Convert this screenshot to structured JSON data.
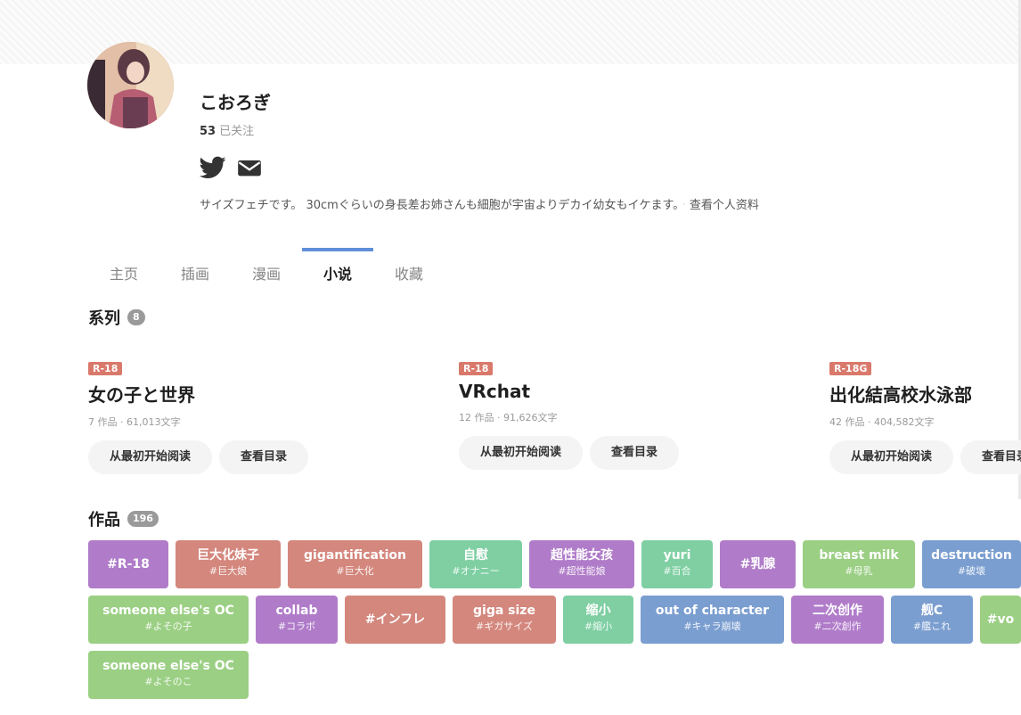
{
  "profile": {
    "username": "こおろぎ",
    "following_count": "53",
    "following_label": "已关注",
    "bio": "サイズフェチです。 30cmぐらいの身長差お姉さんも細胞が宇宙よりデカイ幼女もイケます。",
    "view_profile": "查看个人资料",
    "social_icons": [
      "twitter-icon",
      "mail-icon"
    ]
  },
  "tabs": [
    "主页",
    "插画",
    "漫画",
    "小说",
    "收藏"
  ],
  "active_tab": "小说",
  "series_section": {
    "title": "系列",
    "count": "8",
    "items": [
      {
        "rating": "R-18",
        "title": "女の子と世界",
        "meta": "7 作品 · 61,013文字",
        "read_label": "从最初开始阅读",
        "toc_label": "查看目录"
      },
      {
        "rating": "R-18",
        "title": "VRchat",
        "meta": "12 作品 · 91,626文字",
        "read_label": "从最初开始阅读",
        "toc_label": "查看目录"
      },
      {
        "rating": "R-18G",
        "title": "出化結高校水泳部",
        "meta": "42 作品 · 404,582文字",
        "read_label": "从最初开始阅读",
        "toc_label": "查看目录"
      }
    ]
  },
  "works_section": {
    "title": "作品",
    "count": "196",
    "tag_rows": [
      [
        {
          "name": "#R-18",
          "sub": "",
          "color": "#b07cc9"
        },
        {
          "name": "巨大化妹子",
          "sub": "#巨大娘",
          "color": "#d4877d"
        },
        {
          "name": "gigantification",
          "sub": "#巨大化",
          "color": "#d4877d"
        },
        {
          "name": "自慰",
          "sub": "#オナニー",
          "color": "#7fcfa3"
        },
        {
          "name": "超性能女孩",
          "sub": "#超性能娘",
          "color": "#b07cc9"
        },
        {
          "name": "yuri",
          "sub": "#百合",
          "color": "#7fcfa3"
        },
        {
          "name": "#乳腺",
          "sub": "",
          "color": "#b07cc9"
        },
        {
          "name": "breast milk",
          "sub": "#母乳",
          "color": "#9bcf84"
        },
        {
          "name": "destruction",
          "sub": "#破壊",
          "color": "#7b9ed0"
        }
      ],
      [
        {
          "name": "someone else's OC",
          "sub": "#よその子",
          "color": "#9bcf84"
        },
        {
          "name": "collab",
          "sub": "#コラボ",
          "color": "#b07cc9"
        },
        {
          "name": "#インフレ",
          "sub": "",
          "color": "#d4877d"
        },
        {
          "name": "giga size",
          "sub": "#ギガサイズ",
          "color": "#d4877d"
        },
        {
          "name": "缩小",
          "sub": "#縮小",
          "color": "#7fcfa3"
        },
        {
          "name": "out of character",
          "sub": "#キャラ崩壊",
          "color": "#7b9ed0"
        },
        {
          "name": "二次创作",
          "sub": "#二次創作",
          "color": "#b07cc9"
        },
        {
          "name": "舰C",
          "sub": "#艦これ",
          "color": "#7b9ed0"
        },
        {
          "name": "#vo",
          "sub": "",
          "color": "#9bcf84"
        }
      ],
      [
        {
          "name": "someone else's OC",
          "sub": "#よそのこ",
          "color": "#9bcf84"
        }
      ]
    ]
  }
}
